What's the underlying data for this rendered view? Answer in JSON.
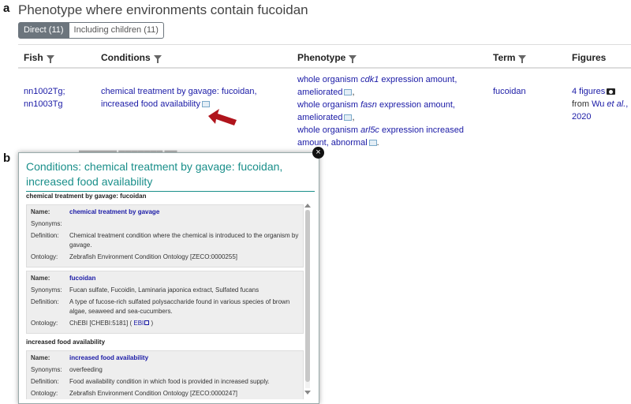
{
  "panels": {
    "a": "a",
    "b": "b"
  },
  "title": "Phenotype where environments contain fucoidan",
  "toggle": {
    "direct": "Direct (11)",
    "including": "Including children (11)"
  },
  "columns": {
    "fish": "Fish",
    "conditions": "Conditions",
    "phenotype": "Phenotype",
    "term": "Term",
    "figures": "Figures"
  },
  "row": {
    "fish_1": "nn1002Tg;",
    "fish_2": "nn1003Tg",
    "conditions_1": "chemical treatment by gavage: fucoidan,",
    "conditions_2": "increased food availability",
    "pheno_1a": "whole organism ",
    "pheno_1b": "cdk1",
    "pheno_1c": " expression amount,",
    "pheno_2": "ameliorated",
    "pheno_3a": "whole organism ",
    "pheno_3b": "fasn",
    "pheno_3c": " expression amount,",
    "pheno_4": "ameliorated",
    "pheno_5a": "whole organism ",
    "pheno_5b": "arl5c",
    "pheno_5c": " expression increased",
    "pheno_6": "amount, abnormal",
    "term": "fucoidan",
    "figures_1": "4 figures",
    "figures_2a": "from ",
    "figures_2b": "Wu ",
    "figures_2c": "et al.",
    "figures_2d": ",",
    "figures_3": "2020"
  },
  "popup": {
    "close": "×",
    "title": "Conditions: chemical treatment by gavage: fucoidan, increased food availability",
    "section1": "chemical treatment by gavage: fucoidan",
    "section2": "increased food availability",
    "labels": {
      "name": "Name:",
      "synonyms": "Synonyms:",
      "definition": "Definition:",
      "ontology": "Ontology:"
    },
    "box1": {
      "name": "chemical treatment by gavage",
      "synonyms": "",
      "definition": "Chemical treatment condition where the chemical is introduced to the organism by gavage.",
      "ontology": "Zebrafish Environment Condition Ontology [ZECO:0000255]"
    },
    "box2": {
      "name": "fucoidan",
      "synonyms": "Fucan sulfate, Fucoidin, Laminaria japonica extract, Sulfated fucans",
      "definition": "A type of fucose-rich sulfated polysaccharide found in various species of brown algae, seaweed and sea-cucumbers.",
      "ontology": "ChEBI [CHEBI:5181]",
      "ontology_open": " ( ",
      "ontology_link": "EBI",
      "ontology_close": " )"
    },
    "box3": {
      "name": "increased food availability",
      "synonyms": "overfeeding",
      "definition": "Food availability condition in which food is provided in increased supply.",
      "ontology": "Zebrafish Environment Condition Ontology [ZECO:0000247]"
    }
  },
  "colors": {
    "link": "#1a1aa6",
    "popup_title": "#1a8f8a",
    "arrow": "#b0141c",
    "toggle_active": "#6c757d"
  }
}
